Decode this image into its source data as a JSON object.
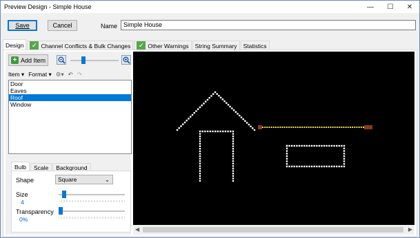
{
  "window": {
    "title": "Preview Design - Simple House",
    "controls": {
      "minimize": "—",
      "maximize": "☐",
      "close": "✕"
    }
  },
  "toolbar": {
    "save_label": "Save",
    "cancel_label": "Cancel",
    "name_label": "Name",
    "name_value": "Simple House"
  },
  "tabs": [
    {
      "label": "Design",
      "checked": false,
      "active": true
    },
    {
      "label": "Channel Conflicts & Bulk Changes",
      "checked": true,
      "active": false
    },
    {
      "label": "Other Warnings",
      "checked": true,
      "active": false
    },
    {
      "label": "String Summary",
      "checked": false,
      "active": false
    },
    {
      "label": "Statistics",
      "checked": false,
      "active": false
    }
  ],
  "design": {
    "add_item_label": "Add Item",
    "zoom_level": 0.25,
    "menu": {
      "item_label": "Item",
      "format_label": "Format"
    },
    "items": [
      {
        "label": "Door",
        "selected": false
      },
      {
        "label": "Eaves",
        "selected": false
      },
      {
        "label": "Roof",
        "selected": true
      },
      {
        "label": "Window",
        "selected": false
      }
    ]
  },
  "properties": {
    "tabs": [
      {
        "label": "Bulb",
        "active": true
      },
      {
        "label": "Scale",
        "active": false
      },
      {
        "label": "Background",
        "active": false
      }
    ],
    "shape_label": "Shape",
    "shape_value": "Square",
    "size_label": "Size",
    "size_value": "4",
    "size_fraction": 0.05,
    "transparency_label": "Transparency",
    "transparency_value": "0%",
    "transparency_fraction": 0.0
  },
  "colors": {
    "accent": "#0078d7",
    "bulb_white": "#ffffff",
    "bulb_yellow": "#f5e05a",
    "endpoint_brown": "#8a3a16",
    "canvas_bg": "#000000",
    "check_green": "#54a84a"
  }
}
